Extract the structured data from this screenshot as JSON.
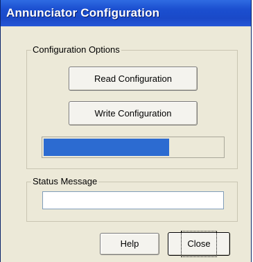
{
  "window": {
    "title": "Annunciator Configuration"
  },
  "config_group": {
    "label": "Configuration Options",
    "read_button": "Read Configuration",
    "write_button": "Write Configuration",
    "progress_fraction": 0.7
  },
  "status_group": {
    "label": "Status Message",
    "message": ""
  },
  "footer": {
    "help_button": "Help",
    "close_button": "Close"
  },
  "colors": {
    "titlebar": "#1b4fd0",
    "progress_fill": "#2c6bd1",
    "dialog_background": "#ece9d8"
  }
}
